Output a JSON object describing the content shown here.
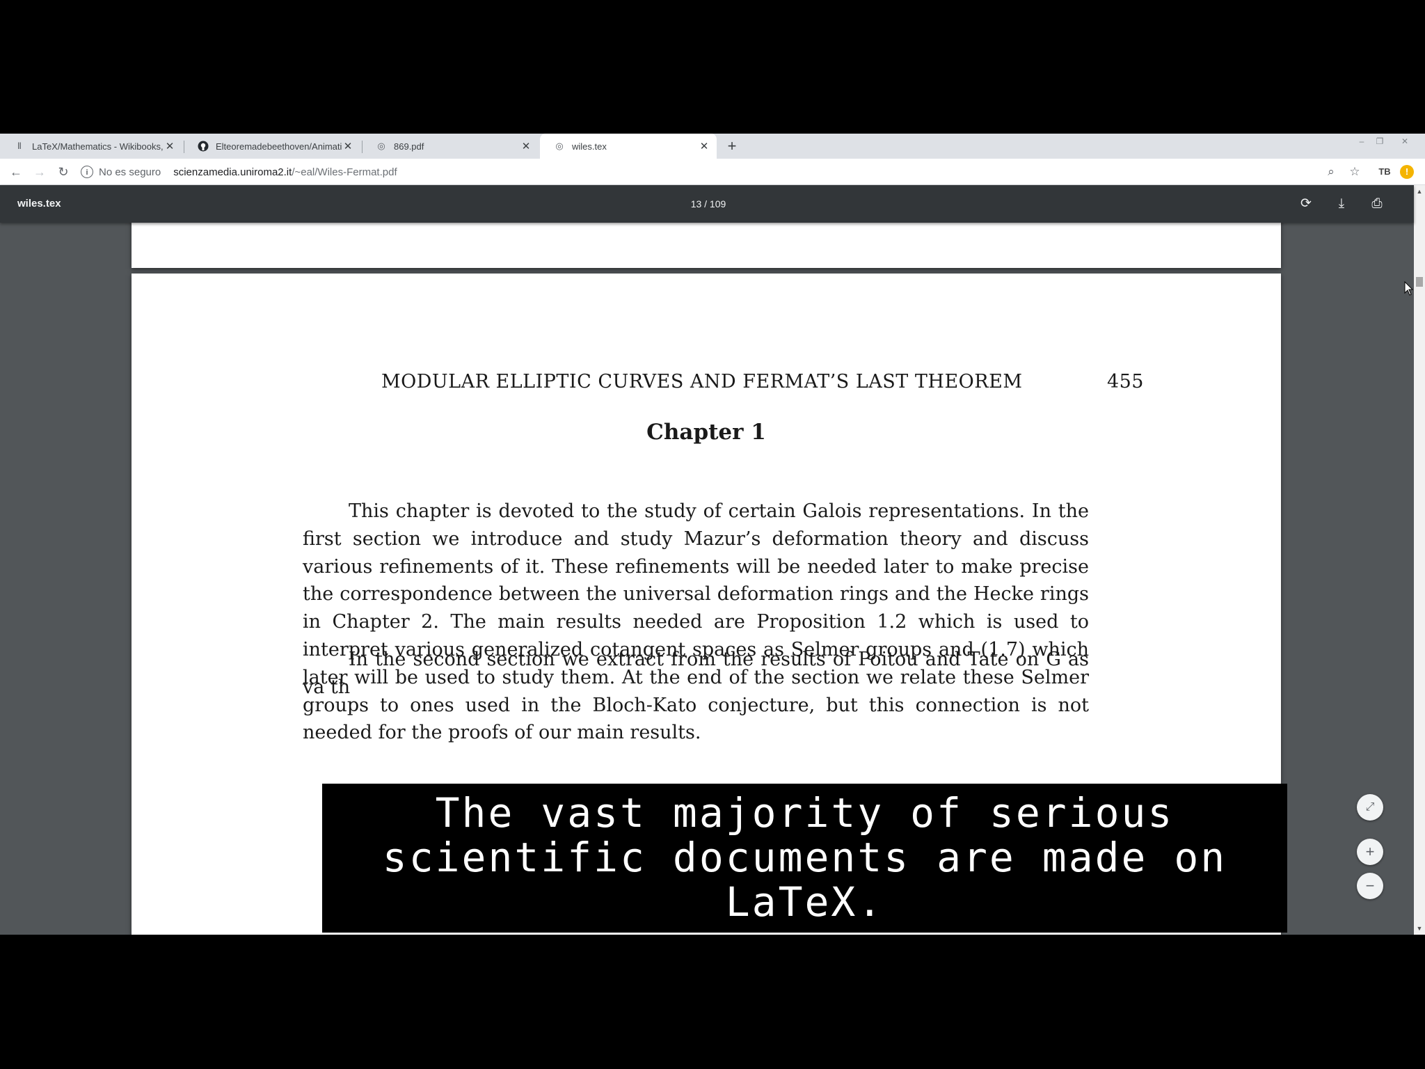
{
  "browser": {
    "tabs": [
      {
        "title": "LaTeX/Mathematics - Wikibooks, op",
        "icon": "wikibooks-icon",
        "active": false
      },
      {
        "title": "Elteoremadebeethoven/AnimationsWi",
        "icon": "github-icon",
        "active": false
      },
      {
        "title": "869.pdf",
        "icon": "globe-icon",
        "active": false
      },
      {
        "title": "wiles.tex",
        "icon": "globe-icon",
        "active": true
      }
    ],
    "security_label": "No es seguro",
    "url_host": "scienzamedia.uniroma2.it",
    "url_path": "/~eal/Wiles-Fermat.pdf",
    "extension_label": "TB"
  },
  "pdf_viewer": {
    "title": "wiles.tex",
    "page_indicator": "13 / 109"
  },
  "document": {
    "running_head_title": "MODULAR ELLIPTIC CURVES AND FERMAT’S LAST THEOREM",
    "running_head_page": "455",
    "chapter_heading": "Chapter 1",
    "paragraph1": "This chapter is devoted to the study of certain Galois representations. In the first section we introduce and study Mazur’s deformation theory and discuss various refinements of it. These refinements will be needed later to make precise the correspondence between the universal deformation rings and the Hecke rings in Chapter 2. The main results needed are Proposition 1.2 which is used to interpret various generalized cotangent spaces as Selmer groups and (1.7) which later will be used to study them. At the end of the section we relate these Selmer groups to ones used in the Bloch-Kato conjecture, but this connection is not needed for the proofs of our main results.",
    "paragraph2": "In the second section we extract from the results of Poitou and Tate on G as va th"
  },
  "subtitle": {
    "text": "The vast majority of serious scientific documents are made on LaTeX."
  }
}
